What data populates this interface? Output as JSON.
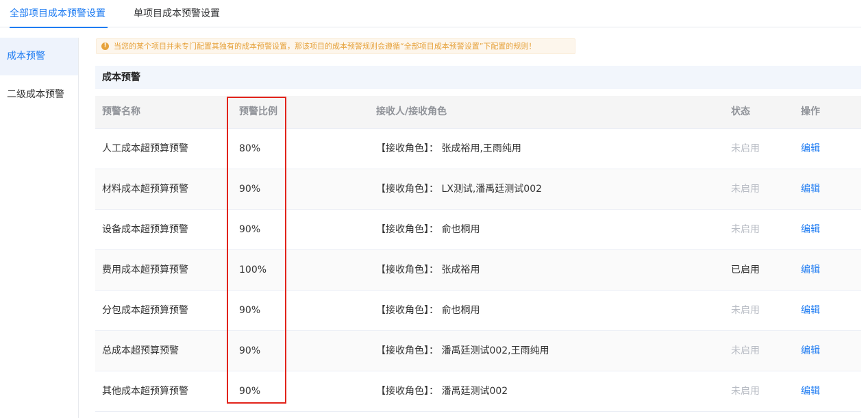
{
  "tabs": [
    {
      "label": "全部项目成本预警设置",
      "active": true
    },
    {
      "label": "单项目成本预警设置",
      "active": false
    }
  ],
  "sidebar": {
    "items": [
      {
        "label": "成本预警",
        "active": true
      },
      {
        "label": "二级成本预警",
        "active": false
      }
    ]
  },
  "notice": {
    "icon": "info-icon",
    "text": "当您的某个项目并未专门配置其独有的成本预警设置，那该项目的成本预警规则会遵循“全部项目成本预警设置”下配置的规则！"
  },
  "section": {
    "title": "成本预警"
  },
  "table": {
    "columns": [
      "预警名称",
      "预警比例",
      "接收人/接收角色",
      "状态",
      "操作"
    ],
    "rows": [
      {
        "name": "人工成本超预算预警",
        "ratio": "80%",
        "receivers": "【接收角色】： 张成裕用,王雨纯用",
        "status": "未启用",
        "action": "编辑"
      },
      {
        "name": "材料成本超预算预警",
        "ratio": "90%",
        "receivers": "【接收角色】： LX测试,潘禹廷测试002",
        "status": "未启用",
        "action": "编辑"
      },
      {
        "name": "设备成本超预算预警",
        "ratio": "90%",
        "receivers": "【接收角色】： 俞也桐用",
        "status": "未启用",
        "action": "编辑"
      },
      {
        "name": "费用成本超预算预警",
        "ratio": "100%",
        "receivers": "【接收角色】： 张成裕用",
        "status": "已启用",
        "action": "编辑"
      },
      {
        "name": "分包成本超预算预警",
        "ratio": "90%",
        "receivers": "【接收角色】： 俞也桐用",
        "status": "未启用",
        "action": "编辑"
      },
      {
        "name": "总成本超预算预警",
        "ratio": "90%",
        "receivers": "【接收角色】： 潘禹廷测试002,王雨纯用",
        "status": "未启用",
        "action": "编辑"
      },
      {
        "name": "其他成本超预算预警",
        "ratio": "90%",
        "receivers": "【接收角色】： 潘禹廷测试002",
        "status": "未启用",
        "action": "编辑"
      }
    ]
  },
  "colors": {
    "accent": "#1f7cf2",
    "warning": "#e6a23c",
    "highlight_border": "#e2231a",
    "status_disabled": "#b8bcc4"
  }
}
